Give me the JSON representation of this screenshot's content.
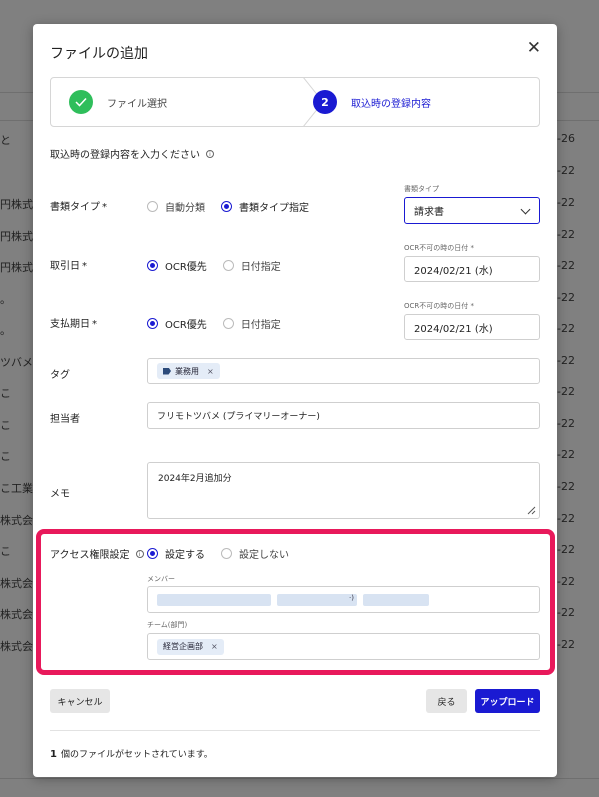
{
  "background": {
    "left_texts": [
      "と",
      "円株式会",
      "円株式会",
      "円株式会",
      "。",
      "。",
      "ツバメ",
      "こ",
      "こ",
      "こ",
      "こ",
      "こ工業",
      "株式会",
      "こ",
      "株式会",
      "株式会",
      "株式会"
    ],
    "right_texts": [
      "-26",
      "-22",
      "-22",
      "-22",
      "-22",
      "-22",
      "-22",
      "-22",
      "-22",
      "-22",
      "-22",
      "-22",
      "-22",
      "-22",
      "-22",
      "-22",
      "-22"
    ]
  },
  "modal": {
    "title": "ファイルの追加",
    "close_icon": "close-icon"
  },
  "stepper": {
    "step1_label": "ファイル選択",
    "step2_number": "2",
    "step2_label": "取込時の登録内容"
  },
  "form": {
    "section_title": "取込時の登録内容を入力ください",
    "doc_type": {
      "label": "書類タイプ",
      "required": "*",
      "options": [
        "自動分類",
        "書類タイプ指定"
      ],
      "selected": "書類タイプ指定",
      "caption": "書類タイプ",
      "value": "請求書"
    },
    "transaction_date": {
      "label": "取引日",
      "required": "*",
      "options": [
        "OCR優先",
        "日付指定"
      ],
      "selected": "OCR優先",
      "caption": "OCR不可の時の日付 *",
      "value": "2024/02/21 (水)"
    },
    "due_date": {
      "label": "支払期日",
      "required": "*",
      "options": [
        "OCR優先",
        "日付指定"
      ],
      "selected": "OCR優先",
      "caption": "OCR不可の時の日付 *",
      "value": "2024/02/21 (水)"
    },
    "tag": {
      "label": "タグ",
      "chip": "業務用",
      "remove": "×"
    },
    "assignee": {
      "label": "担当者",
      "value": "フリモトツバメ (プライマリーオーナー)"
    },
    "memo": {
      "label": "メモ",
      "value": "2024年2月追加分"
    },
    "access": {
      "label": "アクセス権限設定",
      "options": [
        "設定する",
        "設定しない"
      ],
      "selected": "設定する",
      "members_caption": "メンバー",
      "members_suffix": "·)",
      "team_caption": "チーム(部門)",
      "team_chip": "経営企画部",
      "remove": "×"
    }
  },
  "buttons": {
    "cancel": "キャンセル",
    "back": "戻る",
    "upload": "アップロード"
  },
  "footer": {
    "count": "1",
    "text": "個のファイルがセットされています。"
  },
  "colors": {
    "accent": "#1a1ad2",
    "success": "#2fbe5b",
    "highlight": "#e8195b"
  }
}
